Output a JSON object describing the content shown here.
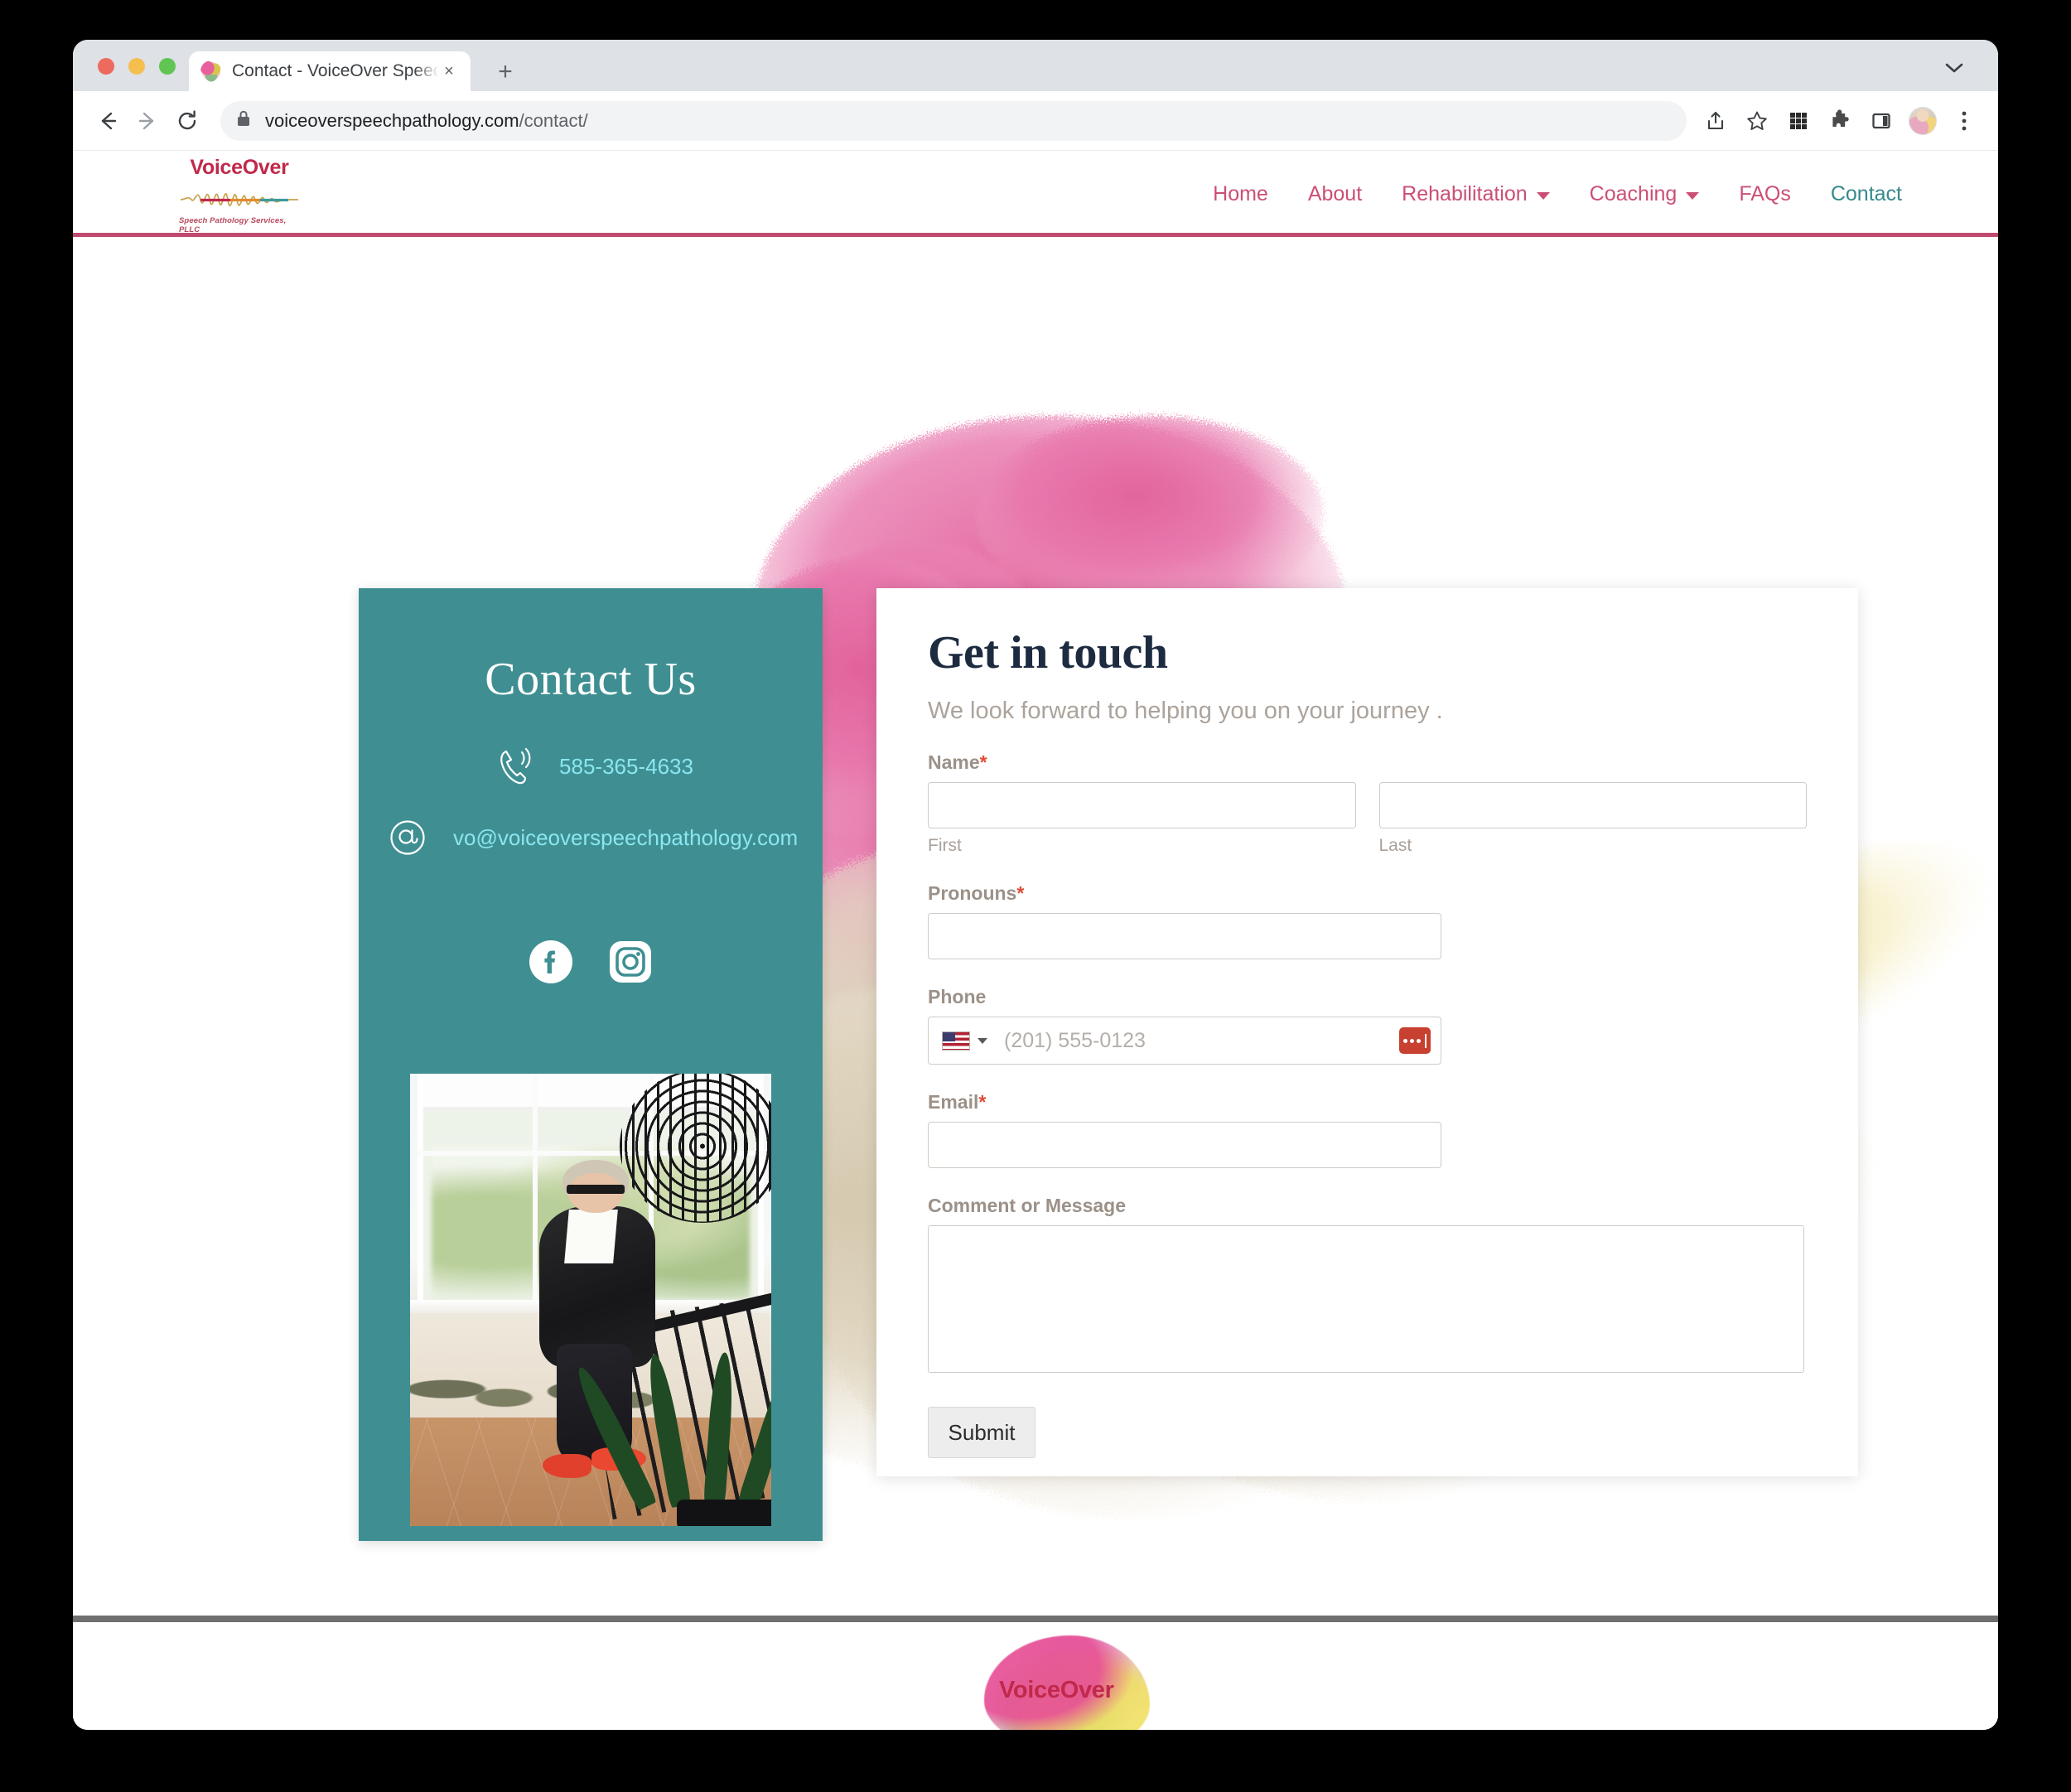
{
  "browser": {
    "tab": {
      "title": "Contact - VoiceOver Speech Pa",
      "favicon": "watercolor-logo-favicon",
      "close": "×"
    },
    "new_tab": "+",
    "tab_list_chevron": "chevron-down-icon",
    "back": "←",
    "forward": "→",
    "reload": "⟳",
    "url_domain": "voiceoverspeechpathology.com",
    "url_path": "/contact/",
    "lock": "lock-icon",
    "toolbar_icons": [
      "share-icon",
      "bookmark-star-icon",
      "apps-grid-icon",
      "extensions-puzzle-icon",
      "side-panel-icon",
      "profile-avatar",
      "more-menu-icon"
    ]
  },
  "site": {
    "logo": {
      "word": "VoiceOver",
      "tagline": "Speech Pathology Services, PLLC"
    },
    "nav": [
      {
        "label": "Home",
        "active": false,
        "has_caret": false
      },
      {
        "label": "About",
        "active": false,
        "has_caret": false
      },
      {
        "label": "Rehabilitation",
        "active": false,
        "has_caret": true
      },
      {
        "label": "Coaching",
        "active": false,
        "has_caret": true
      },
      {
        "label": "FAQs",
        "active": false,
        "has_caret": false
      },
      {
        "label": "Contact",
        "active": true,
        "has_caret": false
      }
    ]
  },
  "contact_card": {
    "title": "Contact Us",
    "phone_icon": "phone-ringing-icon",
    "phone": "585-365-4633",
    "email_icon": "at-sign-icon",
    "email": "vo@voiceoverspeechpathology.com",
    "socials": [
      {
        "name": "facebook-icon"
      },
      {
        "name": "instagram-icon"
      }
    ],
    "photo_alt": "portrait-photo"
  },
  "form": {
    "title": "Get in touch",
    "subtitle": "We look forward to helping you on your journey .",
    "name": {
      "label": "Name",
      "required": "*",
      "first": {
        "value": "",
        "placeholder": "",
        "sub_label": "First"
      },
      "last": {
        "value": "",
        "placeholder": "",
        "sub_label": "Last"
      }
    },
    "pronouns": {
      "label": "Pronouns",
      "required": "*",
      "value": "",
      "placeholder": ""
    },
    "phone": {
      "label": "Phone",
      "required": "",
      "country": "US",
      "flag": "us-flag-icon",
      "placeholder": "(201) 555-0123",
      "value": "",
      "autofill_icon": "autofill-icon"
    },
    "email": {
      "label": "Email",
      "required": "*",
      "value": "",
      "placeholder": ""
    },
    "message": {
      "label": "Comment or Message",
      "value": "",
      "placeholder": ""
    },
    "submit_label": "Submit"
  },
  "footer": {
    "logo_word": "VoiceOver"
  },
  "colors": {
    "teal": "#3f8f92",
    "crimson": "#c0294b",
    "nav_pink": "#cb4f74",
    "navy": "#1d2b40",
    "label_gray": "#9b9188",
    "cyan_link": "#8ae6ef",
    "required_red": "#e04a36",
    "splash_pink": "#e878a8",
    "splash_cream": "#ded3bd"
  }
}
